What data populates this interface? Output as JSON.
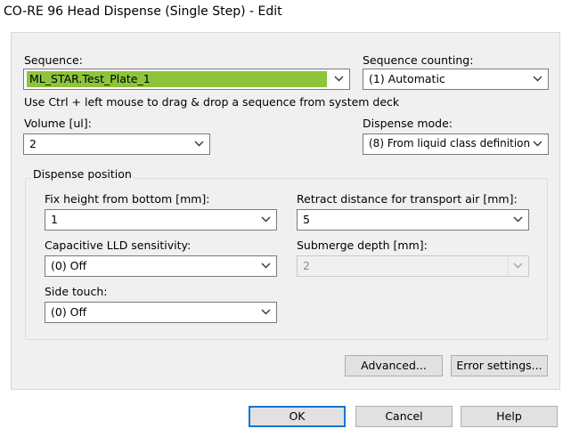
{
  "window": {
    "title": "CO-RE 96 Head Dispense (Single Step) - Edit"
  },
  "sequence": {
    "label": "Sequence:",
    "value": "ML_STAR.Test_Plate_1"
  },
  "sequence_counting": {
    "label": "Sequence counting:",
    "value": "(1) Automatic"
  },
  "hint": "Use Ctrl + left mouse to drag & drop a sequence from system deck",
  "volume": {
    "label": "Volume [ul]:",
    "value": "2"
  },
  "dispense_mode": {
    "label": "Dispense mode:",
    "value": "(8) From liquid class definition"
  },
  "dispense_position": {
    "title": "Dispense position",
    "fix_height": {
      "label": "Fix height from bottom [mm]:",
      "value": "1"
    },
    "retract_distance": {
      "label": "Retract distance for transport air [mm]:",
      "value": "5"
    },
    "capacitive_lld": {
      "label": "Capacitive LLD sensitivity:",
      "value": "(0) Off"
    },
    "submerge_depth": {
      "label": "Submerge depth [mm]:",
      "value": "2"
    },
    "side_touch": {
      "label": "Side touch:",
      "value": "(0) Off"
    }
  },
  "buttons": {
    "advanced": "Advanced...",
    "error_settings": "Error settings...",
    "ok": "OK",
    "cancel": "Cancel",
    "help": "Help"
  },
  "colors": {
    "selection": "#8dc43c",
    "focus": "#0078d7",
    "panel": "#f0f0f0"
  },
  "icons": [
    "chevron-down-icon"
  ]
}
